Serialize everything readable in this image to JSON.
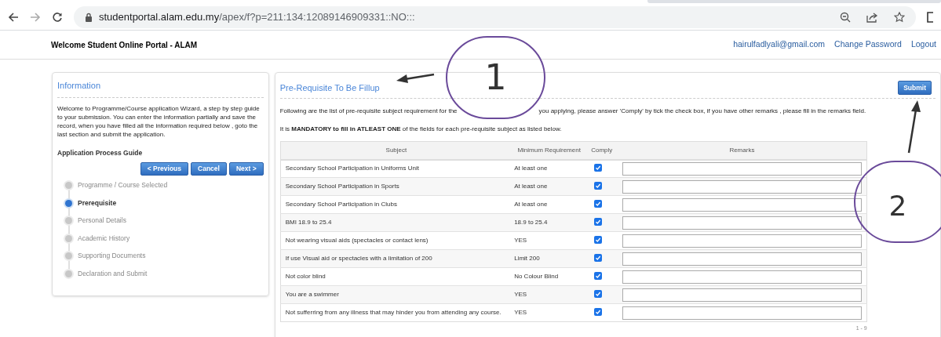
{
  "browser": {
    "url_host": "studentportal.alam.edu.my",
    "url_path": "/apex/f?p=211:134:12089146909331::NO:::"
  },
  "header": {
    "title": "Welcome Student Online Portal - ALAM",
    "links": [
      "hairulfadlyali@gmail.com",
      "Change Password",
      "Logout"
    ]
  },
  "info_panel": {
    "title": "Information",
    "text": "Welcome to Programme/Course application Wizard, a step by step guide to your submission. You can enter the information partially and save the record, when you have filled all the information required below , goto the last section and submit the application.",
    "guide_title": "Application Process Guide",
    "buttons": [
      "< Previous",
      "Cancel",
      "Next >"
    ],
    "steps": [
      {
        "label": "Programme / Course Selected",
        "selected": false
      },
      {
        "label": "Prerequisite",
        "selected": true
      },
      {
        "label": "Personal Details",
        "selected": false
      },
      {
        "label": "Academic History",
        "selected": false
      },
      {
        "label": "Supporting Documents",
        "selected": false
      },
      {
        "label": "Declaration and Submit",
        "selected": false
      }
    ]
  },
  "main_panel": {
    "title": "Pre-Requisite To Be Fillup",
    "submit": "Submit",
    "description_parts": [
      "Following are the list of pre-requisite subject requirement for the",
      "you applying, please answer 'Comply' by tick the check box, if you have other remarks , please fill in the remarks field."
    ],
    "mandatory": "It is **MANDATORY to fill in ATLEAST ONE** of the fields for each pre-requisite subject as listed below.",
    "table": {
      "columns": [
        "Subject",
        "Minimum Requirement",
        "Comply",
        "Remarks"
      ],
      "rows": [
        {
          "subject": "Secondary School Participation in Uniforms Unit",
          "minimum": "At least one",
          "comply": true
        },
        {
          "subject": "Secondary School Participation in Sports",
          "minimum": "At least one",
          "comply": true
        },
        {
          "subject": "Secondary School Participation in Clubs",
          "minimum": "At least one",
          "comply": true
        },
        {
          "subject": "BMI 18.9 to 25.4",
          "minimum": "18.9 to 25.4",
          "comply": true
        },
        {
          "subject": "Not wearing visual aids (spectacles or contact lens)",
          "minimum": "YES",
          "comply": true
        },
        {
          "subject": "If use Visual aid or spectacles with a limitation of 200",
          "minimum": "Limit 200",
          "comply": true
        },
        {
          "subject": "Not color blind",
          "minimum": "No Colour Blind",
          "comply": true
        },
        {
          "subject": "You are a swimmer",
          "minimum": "YES",
          "comply": true
        },
        {
          "subject": "Not sufferring from any illness that may hinder you from attending any course.",
          "minimum": "YES",
          "comply": true
        }
      ]
    },
    "pagination": "1 - 9"
  },
  "annotations": [
    {
      "label": "1"
    },
    {
      "label": "2"
    }
  ]
}
